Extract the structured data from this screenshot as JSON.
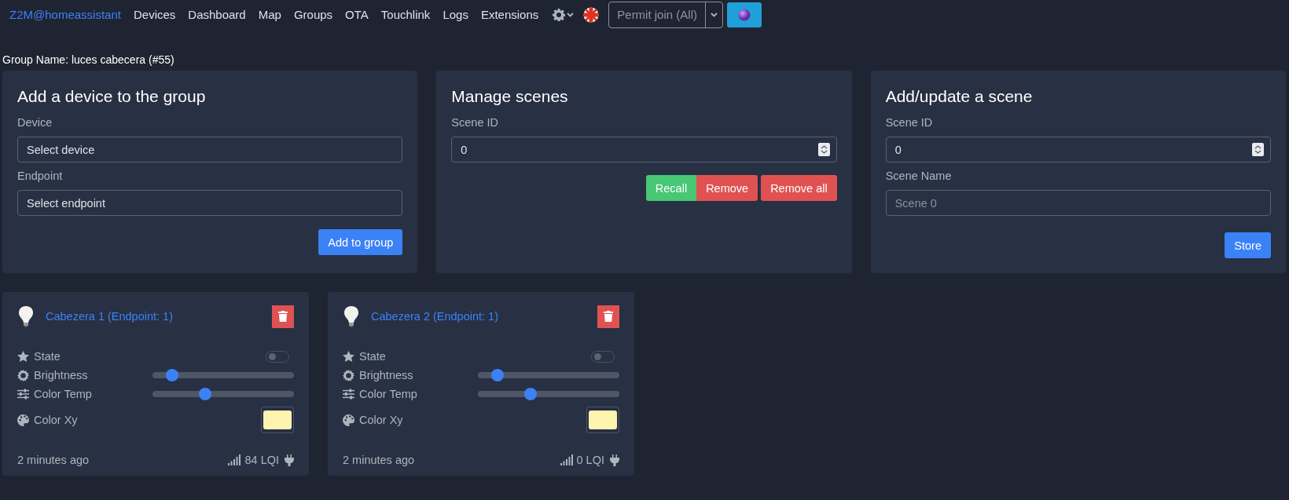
{
  "nav": {
    "brand": "Z2M@homeassistant",
    "links": [
      "Devices",
      "Dashboard",
      "Map",
      "Groups",
      "OTA",
      "Touchlink",
      "Logs",
      "Extensions"
    ],
    "permit_join": "Permit join (All)"
  },
  "group_name": "Group Name: luces cabecera (#55)",
  "panels": [
    {
      "kind": "add_device",
      "title": "Add a device to the group",
      "fields": [
        {
          "label": "Device",
          "kind": "select",
          "value": "Select device"
        },
        {
          "label": "Endpoint",
          "kind": "select",
          "value": "Select endpoint"
        }
      ],
      "buttons": [
        {
          "label": "Add to group",
          "kind": "primary"
        }
      ]
    },
    {
      "kind": "manage_scenes",
      "title": "Manage scenes",
      "fields": [
        {
          "label": "Scene ID",
          "kind": "number",
          "value": "0"
        }
      ],
      "buttons": [
        {
          "label": "Recall",
          "kind": "success"
        },
        {
          "label": "Remove",
          "kind": "danger"
        },
        {
          "label": "Remove all",
          "kind": "danger"
        }
      ]
    },
    {
      "kind": "add_scene",
      "title": "Add/update a scene",
      "fields": [
        {
          "label": "Scene ID",
          "kind": "number",
          "value": "0"
        },
        {
          "label": "Scene Name",
          "kind": "text",
          "placeholder": "Scene 0"
        }
      ],
      "buttons": [
        {
          "label": "Store",
          "kind": "primary"
        }
      ]
    }
  ],
  "devices": [
    {
      "title": "Cabezera 1 (Endpoint: 1)",
      "rows": [
        {
          "kind": "toggle",
          "label": "State",
          "on": false
        },
        {
          "kind": "slider",
          "label": "Brightness",
          "level": 0.14
        },
        {
          "kind": "slider",
          "label": "Color Temp",
          "level": 0.37
        },
        {
          "kind": "color",
          "label": "Color Xy",
          "color": "#fff3b0"
        }
      ],
      "last_seen": "2 minutes ago",
      "lqi": "84 LQI"
    },
    {
      "title": "Cabezera 2 (Endpoint: 1)",
      "rows": [
        {
          "kind": "toggle",
          "label": "State",
          "on": false
        },
        {
          "kind": "slider",
          "label": "Brightness",
          "level": 0.14
        },
        {
          "kind": "slider",
          "label": "Color Temp",
          "level": 0.37
        },
        {
          "kind": "color",
          "label": "Color Xy",
          "color": "#fff3b0"
        }
      ],
      "last_seen": "2 minutes ago",
      "lqi": "0 LQI"
    }
  ]
}
